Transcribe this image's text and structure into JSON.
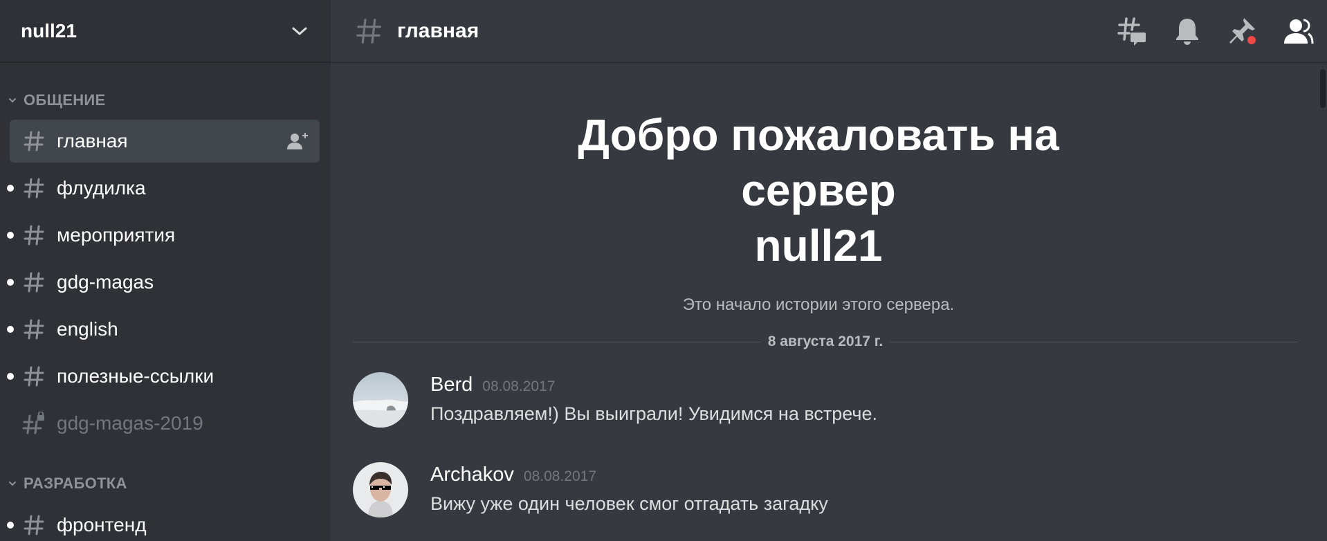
{
  "server": {
    "name": "null21"
  },
  "categories": [
    {
      "name": "ОБЩЕНИЕ",
      "channels": [
        {
          "name": "главная",
          "active": true,
          "unread": false,
          "locked": false
        },
        {
          "name": "флудилка",
          "active": false,
          "unread": true,
          "locked": false
        },
        {
          "name": "мероприятия",
          "active": false,
          "unread": true,
          "locked": false
        },
        {
          "name": "gdg-magas",
          "active": false,
          "unread": true,
          "locked": false
        },
        {
          "name": "english",
          "active": false,
          "unread": true,
          "locked": false
        },
        {
          "name": "полезные-ссылки",
          "active": false,
          "unread": true,
          "locked": false
        },
        {
          "name": "gdg-magas-2019",
          "active": false,
          "unread": false,
          "locked": true
        }
      ]
    },
    {
      "name": "РАЗРАБОТКА",
      "channels": [
        {
          "name": "фронтенд",
          "active": false,
          "unread": true,
          "locked": false
        }
      ]
    }
  ],
  "topbar": {
    "channel_name": "главная",
    "icons": [
      "threads-icon",
      "bell-icon",
      "pin-icon",
      "members-icon"
    ]
  },
  "welcome": {
    "title_line1": "Добро пожаловать на",
    "title_line2": "сервер",
    "title_line3": "null21",
    "subtitle": "Это начало истории этого сервера."
  },
  "date_divider": "8 августа 2017 г.",
  "messages": [
    {
      "author": "Berd",
      "timestamp": "08.08.2017",
      "text": "Поздравляем!) Вы выиграли! Увидимся на встрече."
    },
    {
      "author": "Archakov",
      "timestamp": "08.08.2017",
      "text": "Вижу уже один человек смог отгадать загадку"
    }
  ],
  "colors": {
    "sidebar_bg": "#2f3136",
    "main_bg": "#36393f",
    "active_channel_bg": "#42464d",
    "notification_red": "#f04747"
  }
}
